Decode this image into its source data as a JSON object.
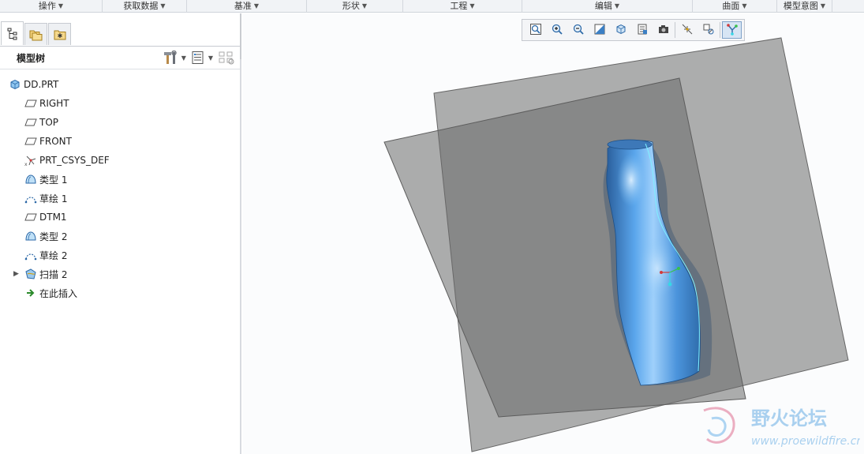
{
  "ribbon_groups": [
    {
      "label": "操作",
      "w": 130
    },
    {
      "label": "获取数据",
      "w": 107
    },
    {
      "label": "基准",
      "w": 152
    },
    {
      "label": "形状",
      "w": 122
    },
    {
      "label": "工程",
      "w": 151
    },
    {
      "label": "编辑",
      "w": 216
    },
    {
      "label": "曲面",
      "w": 107
    },
    {
      "label": "模型意图",
      "w": 70
    }
  ],
  "panel": {
    "tree_title": "模型树"
  },
  "tree": [
    {
      "label": "DD.PRT",
      "icon": "part-icon",
      "level": 0,
      "expander": ""
    },
    {
      "label": "RIGHT",
      "icon": "datum-plane-icon",
      "level": 1,
      "expander": ""
    },
    {
      "label": "TOP",
      "icon": "datum-plane-icon",
      "level": 1,
      "expander": ""
    },
    {
      "label": "FRONT",
      "icon": "datum-plane-icon",
      "level": 1,
      "expander": ""
    },
    {
      "label": "PRT_CSYS_DEF",
      "icon": "csys-icon",
      "level": 1,
      "expander": ""
    },
    {
      "label": "类型 1",
      "icon": "style-surface-icon",
      "level": 1,
      "expander": ""
    },
    {
      "label": "草绘 1",
      "icon": "sketch-icon",
      "level": 1,
      "expander": ""
    },
    {
      "label": "DTM1",
      "icon": "datum-plane-icon",
      "level": 1,
      "expander": ""
    },
    {
      "label": "类型 2",
      "icon": "style-surface-icon",
      "level": 1,
      "expander": ""
    },
    {
      "label": "草绘 2",
      "icon": "sketch-icon",
      "level": 1,
      "expander": ""
    },
    {
      "label": "扫描 2",
      "icon": "sweep-icon",
      "level": 1,
      "expander": "▶"
    },
    {
      "label": "在此插入",
      "icon": "insert-here-arrow-icon",
      "level": 1,
      "expander": ""
    }
  ],
  "view_toolbar": [
    {
      "name": "refit-icon"
    },
    {
      "name": "zoom-in-icon"
    },
    {
      "name": "zoom-out-icon"
    },
    {
      "name": "repaint-icon"
    },
    {
      "name": "display-style-icon"
    },
    {
      "name": "saved-orientations-icon"
    },
    {
      "name": "view-manager-icon"
    },
    {
      "name": "datum-display-filters-icon"
    },
    {
      "name": "spin-center-icon"
    },
    {
      "name": "annotation-display-icon"
    }
  ],
  "watermark": {
    "title": "野火论坛",
    "url": "www.proewildfire.cn"
  },
  "colors": {
    "accent": "#2e7fd1",
    "plane_fill": "#6f6f6f",
    "model_blue": "#4a9ae0"
  }
}
